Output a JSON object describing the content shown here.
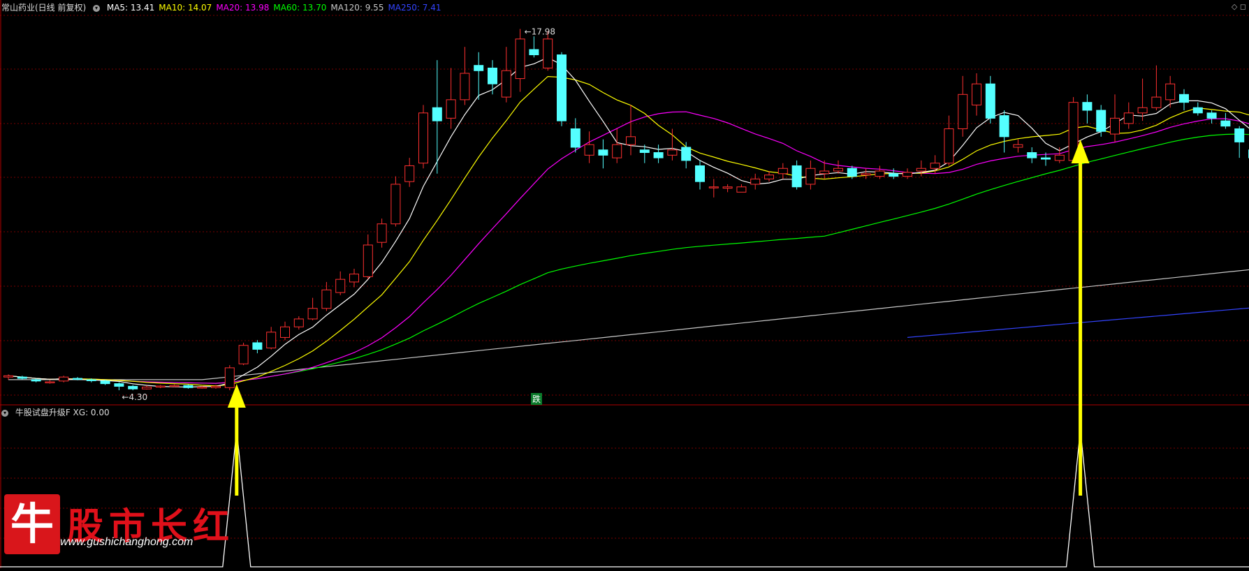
{
  "header": {
    "stock_name": "常山药业(日线 前复权)",
    "ma_items": [
      {
        "label": "MA5: 13.41",
        "color": "#ffffff"
      },
      {
        "label": "MA10: 14.07",
        "color": "#ffff00"
      },
      {
        "label": "MA20: 13.98",
        "color": "#ff00ff"
      },
      {
        "label": "MA60: 13.70",
        "color": "#00ff00"
      },
      {
        "label": "MA120: 9.55",
        "color": "#c8c8c8"
      },
      {
        "label": "MA250: 7.41",
        "color": "#3344ff"
      }
    ],
    "corner_icons": "◇ ◻"
  },
  "indicator_header": "牛股试盘升级F  XG: 0.00",
  "annotations": {
    "high_label": "17.98",
    "low_label": "4.30",
    "signal_tag": "跌"
  },
  "watermark": {
    "logo_char": "牛",
    "brand_text": "股市长红",
    "url": "www.gushichanghong.com"
  },
  "colors": {
    "up": "#ff3030",
    "down": "#54ffff",
    "arrow": "#ffff00",
    "grid": "#7a0000",
    "ma5": "#ffffff",
    "ma10": "#ffff00",
    "ma20": "#ff00ff",
    "ma60": "#00ff00",
    "ma120": "#c8c8c8",
    "ma250": "#3344ff"
  },
  "chart_data": {
    "type": "candlestick",
    "price_range": [
      3.8,
      18.6
    ],
    "candles": [
      [
        4.8,
        4.85,
        4.9,
        4.7
      ],
      [
        4.8,
        4.75,
        4.85,
        4.7
      ],
      [
        4.7,
        4.65,
        4.75,
        4.6
      ],
      [
        4.6,
        4.62,
        4.68,
        4.55
      ],
      [
        4.65,
        4.8,
        4.85,
        4.6
      ],
      [
        4.75,
        4.72,
        4.8,
        4.68
      ],
      [
        4.7,
        4.66,
        4.75,
        4.6
      ],
      [
        4.65,
        4.55,
        4.7,
        4.5
      ],
      [
        4.55,
        4.45,
        4.6,
        4.3
      ],
      [
        4.45,
        4.35,
        4.5,
        4.3
      ],
      [
        4.35,
        4.42,
        4.48,
        4.33
      ],
      [
        4.42,
        4.46,
        4.5,
        4.38
      ],
      [
        4.45,
        4.48,
        4.52,
        4.42
      ],
      [
        4.48,
        4.4,
        4.52,
        4.36
      ],
      [
        4.4,
        4.42,
        4.46,
        4.36
      ],
      [
        4.4,
        4.45,
        4.5,
        4.36
      ],
      [
        4.4,
        5.15,
        5.25,
        4.3
      ],
      [
        5.3,
        6.0,
        6.1,
        5.25
      ],
      [
        6.1,
        5.85,
        6.2,
        5.7
      ],
      [
        5.9,
        6.5,
        6.7,
        5.85
      ],
      [
        6.3,
        6.7,
        6.9,
        6.2
      ],
      [
        6.7,
        7.0,
        7.1,
        6.6
      ],
      [
        7.0,
        7.4,
        7.8,
        6.95
      ],
      [
        7.4,
        8.1,
        8.4,
        7.3
      ],
      [
        8.0,
        8.5,
        8.8,
        7.9
      ],
      [
        8.4,
        8.7,
        8.9,
        8.2
      ],
      [
        8.6,
        9.8,
        10.2,
        8.5
      ],
      [
        9.9,
        10.6,
        10.8,
        9.7
      ],
      [
        10.6,
        12.1,
        12.4,
        10.5
      ],
      [
        12.2,
        12.8,
        13.1,
        12.0
      ],
      [
        12.9,
        14.8,
        15.1,
        12.7
      ],
      [
        15.0,
        14.5,
        16.8,
        12.5
      ],
      [
        14.6,
        15.3,
        16.5,
        14.2
      ],
      [
        15.3,
        16.3,
        17.3,
        15.1
      ],
      [
        16.6,
        16.4,
        17.1,
        15.3
      ],
      [
        16.5,
        15.9,
        16.8,
        15.5
      ],
      [
        15.4,
        16.4,
        17.3,
        15.2
      ],
      [
        16.1,
        17.6,
        17.98,
        15.6
      ],
      [
        17.2,
        17.0,
        17.7,
        16.9
      ],
      [
        16.5,
        17.6,
        17.9,
        16.4
      ],
      [
        17.0,
        14.5,
        17.1,
        14.3
      ],
      [
        14.2,
        13.5,
        14.6,
        13.3
      ],
      [
        13.2,
        13.6,
        14.1,
        12.9
      ],
      [
        13.4,
        13.2,
        13.8,
        12.7
      ],
      [
        13.1,
        13.6,
        14.2,
        12.9
      ],
      [
        13.6,
        13.9,
        15.1,
        13.2
      ],
      [
        13.4,
        13.3,
        13.6,
        12.9
      ],
      [
        13.3,
        13.1,
        13.6,
        12.9
      ],
      [
        13.2,
        13.4,
        14.2,
        13.0
      ],
      [
        13.5,
        13.0,
        13.7,
        12.7
      ],
      [
        12.8,
        12.2,
        13.0,
        11.9
      ],
      [
        12.0,
        12.0,
        12.3,
        11.6
      ],
      [
        11.95,
        12.0,
        12.1,
        11.8
      ],
      [
        11.8,
        12.0,
        12.1,
        11.8
      ],
      [
        12.1,
        12.3,
        12.5,
        11.9
      ],
      [
        12.3,
        12.45,
        12.6,
        12.2
      ],
      [
        12.5,
        12.7,
        12.9,
        12.3
      ],
      [
        12.8,
        12.0,
        13.0,
        11.9
      ],
      [
        12.1,
        12.7,
        13.0,
        11.9
      ],
      [
        12.5,
        12.6,
        13.0,
        12.3
      ],
      [
        12.6,
        12.7,
        13.0,
        12.5
      ],
      [
        12.7,
        12.4,
        12.8,
        12.3
      ],
      [
        12.45,
        12.5,
        12.7,
        12.3
      ],
      [
        12.4,
        12.6,
        12.8,
        12.3
      ],
      [
        12.5,
        12.4,
        12.7,
        12.3
      ],
      [
        12.4,
        12.55,
        12.7,
        12.3
      ],
      [
        12.6,
        12.7,
        13.0,
        12.4
      ],
      [
        12.7,
        12.9,
        13.2,
        12.5
      ],
      [
        12.9,
        14.2,
        14.7,
        12.8
      ],
      [
        14.2,
        15.5,
        16.2,
        13.9
      ],
      [
        15.1,
        15.9,
        16.3,
        14.7
      ],
      [
        15.9,
        14.6,
        16.2,
        14.4
      ],
      [
        14.7,
        13.9,
        14.9,
        13.3
      ],
      [
        13.5,
        13.6,
        13.8,
        13.3
      ],
      [
        13.3,
        13.1,
        13.5,
        12.9
      ],
      [
        13.1,
        13.05,
        13.3,
        12.8
      ],
      [
        13.0,
        13.2,
        13.5,
        12.9
      ],
      [
        13.0,
        15.2,
        15.4,
        12.9
      ],
      [
        15.2,
        14.9,
        15.5,
        14.4
      ],
      [
        14.9,
        14.1,
        15.1,
        13.9
      ],
      [
        14.0,
        14.6,
        15.5,
        13.7
      ],
      [
        14.4,
        14.8,
        15.2,
        14.2
      ],
      [
        14.8,
        15.0,
        16.1,
        14.5
      ],
      [
        15.0,
        15.4,
        16.6,
        14.9
      ],
      [
        15.3,
        15.9,
        16.2,
        15.0
      ],
      [
        15.5,
        15.2,
        15.7,
        14.9
      ],
      [
        15.0,
        14.8,
        15.2,
        14.7
      ],
      [
        14.8,
        14.6,
        14.9,
        14.4
      ],
      [
        14.5,
        14.3,
        14.8,
        14.2
      ],
      [
        14.2,
        13.7,
        14.3,
        13.1
      ],
      [
        13.4,
        13.1,
        14.1,
        13.0
      ],
      [
        13.0,
        12.9,
        13.5,
        12.7
      ]
    ],
    "indicator": {
      "name": "牛股试盘升级F",
      "value_label": "XG: 0.00",
      "signals": [
        16,
        77
      ]
    }
  }
}
